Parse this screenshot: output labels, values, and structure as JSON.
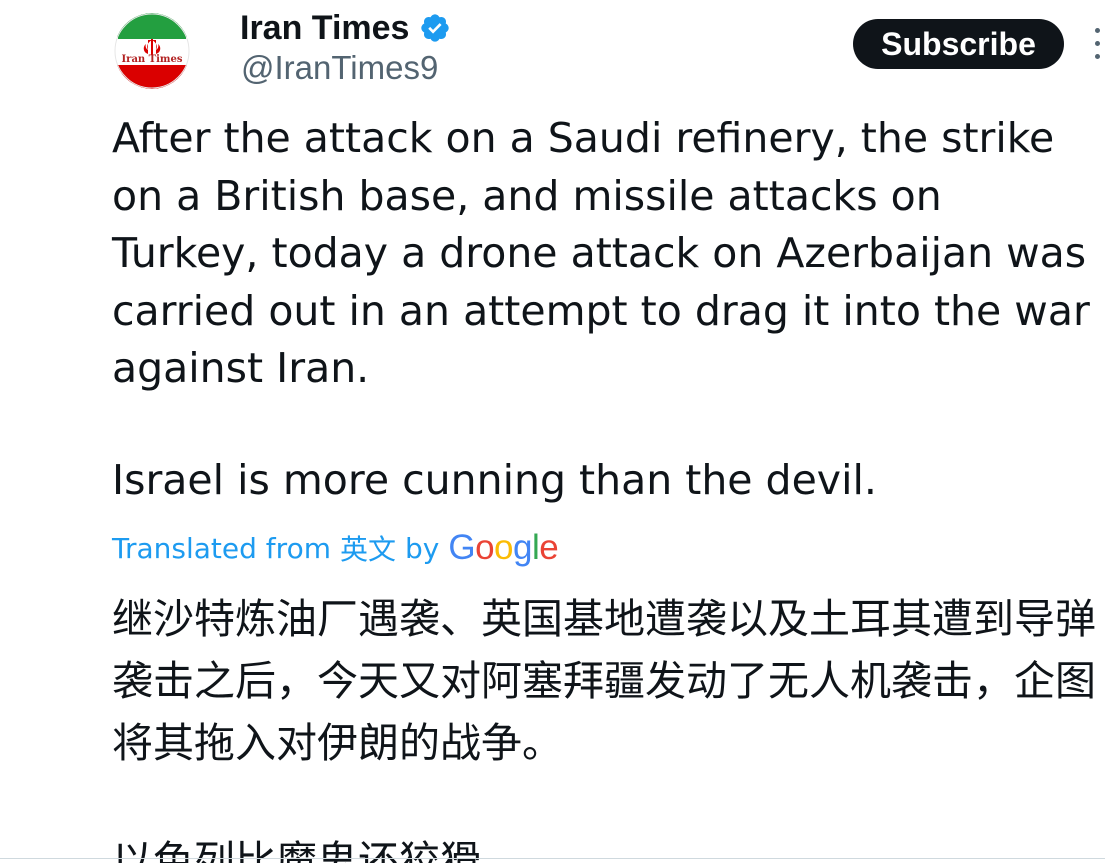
{
  "account": {
    "display_name": "Iran Times",
    "handle": "@IranTimes9",
    "avatar_text": "Iran Times",
    "verified": true
  },
  "subscribe_label": "Subscribe",
  "tweet": {
    "paragraph_1": "After the attack on a Saudi refinery, the strike on a British base, and missile attacks on Turkey, today a drone attack on Azerbaijan was carried out in an attempt to drag it into the war against Iran.",
    "paragraph_2": "Israel is more cunning than the devil."
  },
  "translation": {
    "label_prefix": "Translated from",
    "source_language": "英文",
    "label_by": "by",
    "provider": "Google",
    "paragraph_1": "继沙特炼油厂遇袭、英国基地遭袭以及土耳其遭到导弹袭击之后，今天又对阿塞拜疆发动了无人机袭击，企图将其拖入对伊朗的战争。",
    "paragraph_2": "以色列比魔鬼还狡猾"
  },
  "colors": {
    "text": "#0f1419",
    "secondary_text": "#536471",
    "link": "#1d9bf0",
    "verified_badge": "#1d9bf0",
    "subscribe_bg": "#0f1419"
  },
  "icons": [
    "verified-badge-icon",
    "more-options-icon",
    "google-logo"
  ]
}
